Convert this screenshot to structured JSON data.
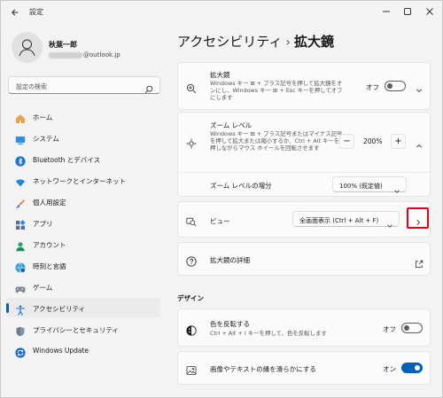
{
  "titlebar": {
    "title": "設定"
  },
  "profile": {
    "name": "秋葉一郎",
    "email_domain": "@outlook.jp"
  },
  "search": {
    "placeholder": "設定の検索"
  },
  "sidebar": {
    "items": [
      {
        "label": "ホーム",
        "icon": "home-icon"
      },
      {
        "label": "システム",
        "icon": "monitor-icon"
      },
      {
        "label": "Bluetooth とデバイス",
        "icon": "bluetooth-icon"
      },
      {
        "label": "ネットワークとインターネット",
        "icon": "wifi-icon"
      },
      {
        "label": "個人用設定",
        "icon": "brush-icon"
      },
      {
        "label": "アプリ",
        "icon": "apps-icon"
      },
      {
        "label": "アカウント",
        "icon": "person-icon"
      },
      {
        "label": "時刻と言語",
        "icon": "globe-clock-icon"
      },
      {
        "label": "ゲーム",
        "icon": "gamepad-icon"
      },
      {
        "label": "アクセシビリティ",
        "icon": "accessibility-icon"
      },
      {
        "label": "プライバシーとセキュリティ",
        "icon": "shield-icon"
      },
      {
        "label": "Windows Update",
        "icon": "update-icon"
      }
    ],
    "active_index": 9
  },
  "breadcrumb": {
    "parent": "アクセシビリティ",
    "separator": "›",
    "current": "拡大鏡"
  },
  "magnifier": {
    "title": "拡大鏡",
    "desc": "Windows キー ⊞ + プラス記号を押して拡大鏡をオンにし、Windows キー ⊞ + Esc キーを押してオフにします",
    "state_label": "オフ",
    "state": false
  },
  "zoom": {
    "title": "ズーム レベル",
    "desc": "Windows キー ⊞ + プラス記号またはマイナス記号を押して拡大または縮小するか、Ctrl + Alt キーを押しながらマウス ホイールを回転させます",
    "minus": "−",
    "value": "200%",
    "plus": "+",
    "increment_label": "ズーム レベルの増分",
    "increment_value": "100% (既定値)"
  },
  "view": {
    "label": "ビュー",
    "value": "全画面表示 (Ctrl + Alt + F)"
  },
  "details": {
    "label": "拡大鏡の詳細"
  },
  "design": {
    "section_title": "デザイン",
    "invert": {
      "title": "色を反転する",
      "desc": "Ctrl + Alt + I キーを押して、色を反転します",
      "state_label": "オフ",
      "state": false
    },
    "smooth": {
      "title": "画像やテキストの縁を滑らかにする",
      "state_label": "オン",
      "state": true
    }
  },
  "colors": {
    "accent": "#005fb8",
    "highlight": "#e0001b"
  }
}
